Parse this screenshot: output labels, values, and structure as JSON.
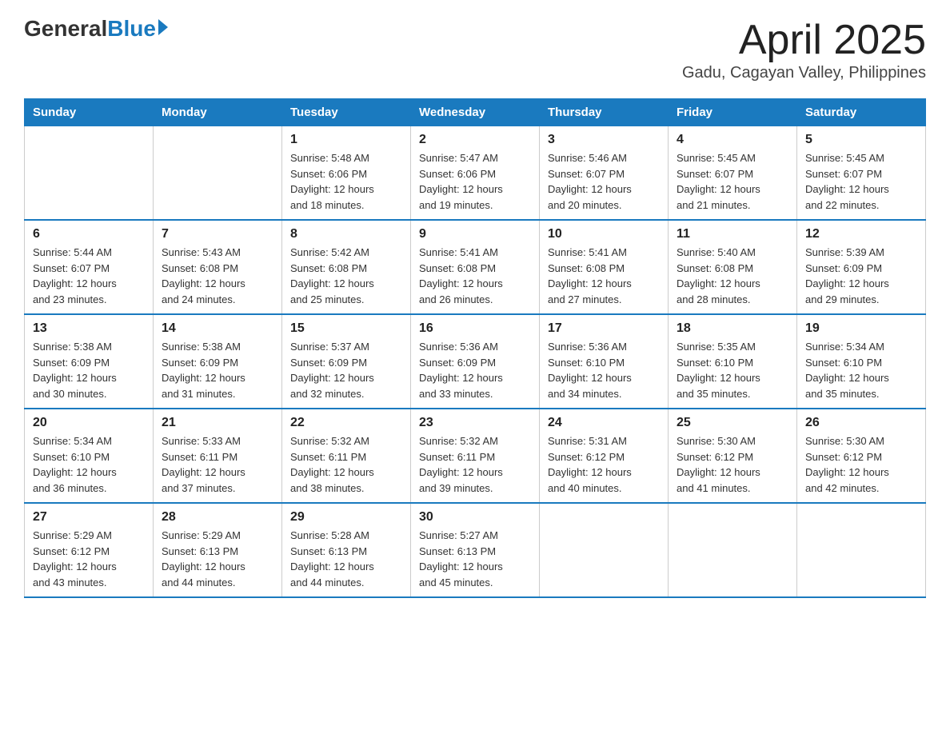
{
  "header": {
    "logo": {
      "general": "General",
      "blue": "Blue"
    },
    "title": "April 2025",
    "location": "Gadu, Cagayan Valley, Philippines"
  },
  "days_of_week": [
    "Sunday",
    "Monday",
    "Tuesday",
    "Wednesday",
    "Thursday",
    "Friday",
    "Saturday"
  ],
  "weeks": [
    [
      {
        "day": "",
        "info": ""
      },
      {
        "day": "",
        "info": ""
      },
      {
        "day": "1",
        "info": "Sunrise: 5:48 AM\nSunset: 6:06 PM\nDaylight: 12 hours\nand 18 minutes."
      },
      {
        "day": "2",
        "info": "Sunrise: 5:47 AM\nSunset: 6:06 PM\nDaylight: 12 hours\nand 19 minutes."
      },
      {
        "day": "3",
        "info": "Sunrise: 5:46 AM\nSunset: 6:07 PM\nDaylight: 12 hours\nand 20 minutes."
      },
      {
        "day": "4",
        "info": "Sunrise: 5:45 AM\nSunset: 6:07 PM\nDaylight: 12 hours\nand 21 minutes."
      },
      {
        "day": "5",
        "info": "Sunrise: 5:45 AM\nSunset: 6:07 PM\nDaylight: 12 hours\nand 22 minutes."
      }
    ],
    [
      {
        "day": "6",
        "info": "Sunrise: 5:44 AM\nSunset: 6:07 PM\nDaylight: 12 hours\nand 23 minutes."
      },
      {
        "day": "7",
        "info": "Sunrise: 5:43 AM\nSunset: 6:08 PM\nDaylight: 12 hours\nand 24 minutes."
      },
      {
        "day": "8",
        "info": "Sunrise: 5:42 AM\nSunset: 6:08 PM\nDaylight: 12 hours\nand 25 minutes."
      },
      {
        "day": "9",
        "info": "Sunrise: 5:41 AM\nSunset: 6:08 PM\nDaylight: 12 hours\nand 26 minutes."
      },
      {
        "day": "10",
        "info": "Sunrise: 5:41 AM\nSunset: 6:08 PM\nDaylight: 12 hours\nand 27 minutes."
      },
      {
        "day": "11",
        "info": "Sunrise: 5:40 AM\nSunset: 6:08 PM\nDaylight: 12 hours\nand 28 minutes."
      },
      {
        "day": "12",
        "info": "Sunrise: 5:39 AM\nSunset: 6:09 PM\nDaylight: 12 hours\nand 29 minutes."
      }
    ],
    [
      {
        "day": "13",
        "info": "Sunrise: 5:38 AM\nSunset: 6:09 PM\nDaylight: 12 hours\nand 30 minutes."
      },
      {
        "day": "14",
        "info": "Sunrise: 5:38 AM\nSunset: 6:09 PM\nDaylight: 12 hours\nand 31 minutes."
      },
      {
        "day": "15",
        "info": "Sunrise: 5:37 AM\nSunset: 6:09 PM\nDaylight: 12 hours\nand 32 minutes."
      },
      {
        "day": "16",
        "info": "Sunrise: 5:36 AM\nSunset: 6:09 PM\nDaylight: 12 hours\nand 33 minutes."
      },
      {
        "day": "17",
        "info": "Sunrise: 5:36 AM\nSunset: 6:10 PM\nDaylight: 12 hours\nand 34 minutes."
      },
      {
        "day": "18",
        "info": "Sunrise: 5:35 AM\nSunset: 6:10 PM\nDaylight: 12 hours\nand 35 minutes."
      },
      {
        "day": "19",
        "info": "Sunrise: 5:34 AM\nSunset: 6:10 PM\nDaylight: 12 hours\nand 35 minutes."
      }
    ],
    [
      {
        "day": "20",
        "info": "Sunrise: 5:34 AM\nSunset: 6:10 PM\nDaylight: 12 hours\nand 36 minutes."
      },
      {
        "day": "21",
        "info": "Sunrise: 5:33 AM\nSunset: 6:11 PM\nDaylight: 12 hours\nand 37 minutes."
      },
      {
        "day": "22",
        "info": "Sunrise: 5:32 AM\nSunset: 6:11 PM\nDaylight: 12 hours\nand 38 minutes."
      },
      {
        "day": "23",
        "info": "Sunrise: 5:32 AM\nSunset: 6:11 PM\nDaylight: 12 hours\nand 39 minutes."
      },
      {
        "day": "24",
        "info": "Sunrise: 5:31 AM\nSunset: 6:12 PM\nDaylight: 12 hours\nand 40 minutes."
      },
      {
        "day": "25",
        "info": "Sunrise: 5:30 AM\nSunset: 6:12 PM\nDaylight: 12 hours\nand 41 minutes."
      },
      {
        "day": "26",
        "info": "Sunrise: 5:30 AM\nSunset: 6:12 PM\nDaylight: 12 hours\nand 42 minutes."
      }
    ],
    [
      {
        "day": "27",
        "info": "Sunrise: 5:29 AM\nSunset: 6:12 PM\nDaylight: 12 hours\nand 43 minutes."
      },
      {
        "day": "28",
        "info": "Sunrise: 5:29 AM\nSunset: 6:13 PM\nDaylight: 12 hours\nand 44 minutes."
      },
      {
        "day": "29",
        "info": "Sunrise: 5:28 AM\nSunset: 6:13 PM\nDaylight: 12 hours\nand 44 minutes."
      },
      {
        "day": "30",
        "info": "Sunrise: 5:27 AM\nSunset: 6:13 PM\nDaylight: 12 hours\nand 45 minutes."
      },
      {
        "day": "",
        "info": ""
      },
      {
        "day": "",
        "info": ""
      },
      {
        "day": "",
        "info": ""
      }
    ]
  ]
}
